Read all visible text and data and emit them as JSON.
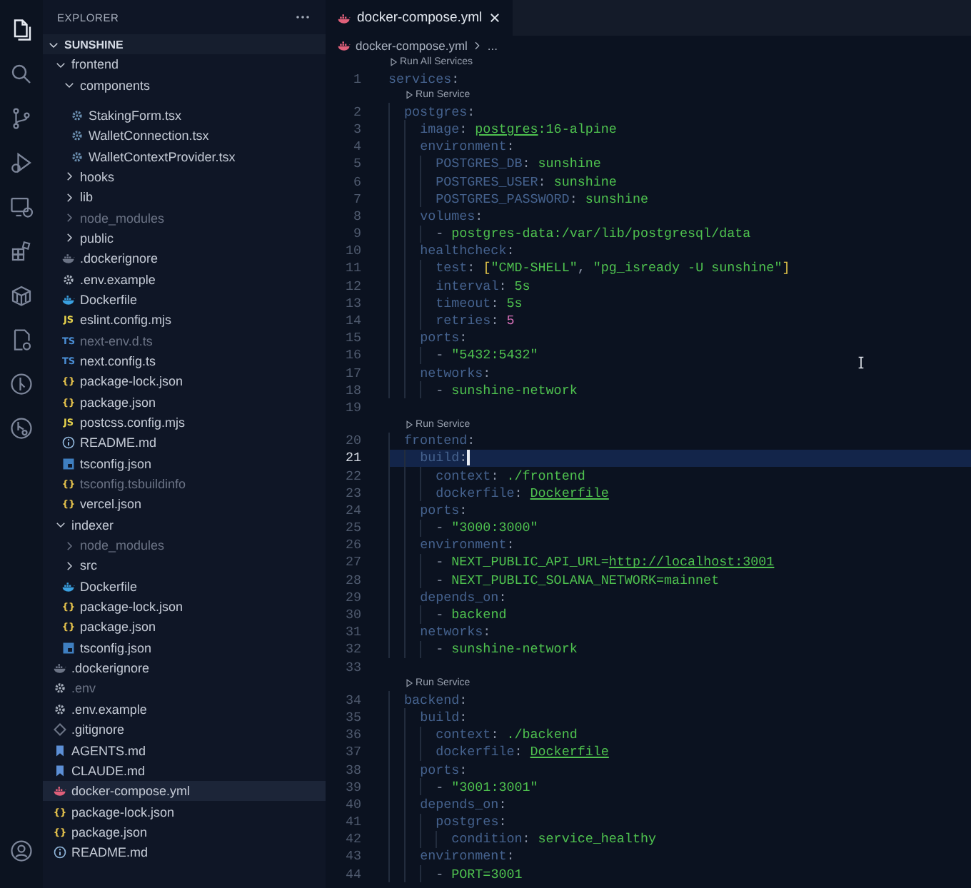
{
  "activity_bar": {
    "items": [
      {
        "kind": "files",
        "selected": true
      },
      {
        "kind": "search",
        "selected": false
      },
      {
        "kind": "scm",
        "selected": false
      },
      {
        "kind": "run",
        "selected": false
      },
      {
        "kind": "remote",
        "selected": false
      },
      {
        "kind": "extensions",
        "selected": false
      },
      {
        "kind": "containers",
        "selected": false
      },
      {
        "kind": "docs",
        "selected": false
      },
      {
        "kind": "graph",
        "selected": false
      },
      {
        "kind": "graph2",
        "selected": false
      }
    ],
    "account": {
      "kind": "account"
    }
  },
  "explorer": {
    "title": "EXPLORER",
    "root": {
      "label": "SUNSHINE",
      "expanded": true
    },
    "tree": [
      {
        "label": "frontend",
        "kind": "folder",
        "expanded": true,
        "selected": false,
        "dimmed": false,
        "children": [
          {
            "label": "components",
            "kind": "folder",
            "expanded": true,
            "selected": false,
            "dimmed": false,
            "children": [
              {
                "label": "StakingForm.tsx",
                "kind": "tsx",
                "selected": false,
                "dimmed": false
              },
              {
                "label": "WalletConnection.tsx",
                "kind": "tsx",
                "selected": false,
                "dimmed": false
              },
              {
                "label": "WalletContextProvider.tsx",
                "kind": "tsx",
                "selected": false,
                "dimmed": false
              }
            ]
          },
          {
            "label": "hooks",
            "kind": "folder",
            "expanded": false,
            "selected": false,
            "dimmed": false
          },
          {
            "label": "lib",
            "kind": "folder",
            "expanded": false,
            "selected": false,
            "dimmed": false
          },
          {
            "label": "node_modules",
            "kind": "folder",
            "expanded": false,
            "selected": false,
            "dimmed": true
          },
          {
            "label": "public",
            "kind": "folder",
            "expanded": false,
            "selected": false,
            "dimmed": false
          },
          {
            "label": ".dockerignore",
            "kind": "dockerignore",
            "selected": false,
            "dimmed": false
          },
          {
            "label": ".env.example",
            "kind": "env",
            "selected": false,
            "dimmed": false
          },
          {
            "label": "Dockerfile",
            "kind": "docker",
            "selected": false,
            "dimmed": false
          },
          {
            "label": "eslint.config.mjs",
            "kind": "js",
            "badge": "JS",
            "selected": false,
            "dimmed": false
          },
          {
            "label": "next-env.d.ts",
            "kind": "ts",
            "badge": "TS",
            "selected": false,
            "dimmed": true
          },
          {
            "label": "next.config.ts",
            "kind": "ts",
            "badge": "TS",
            "selected": false,
            "dimmed": false
          },
          {
            "label": "package-lock.json",
            "kind": "json",
            "badge": "{}",
            "selected": false,
            "dimmed": false
          },
          {
            "label": "package.json",
            "kind": "json",
            "badge": "{}",
            "selected": false,
            "dimmed": false
          },
          {
            "label": "postcss.config.mjs",
            "kind": "js",
            "badge": "JS",
            "selected": false,
            "dimmed": false
          },
          {
            "label": "README.md",
            "kind": "info",
            "selected": false,
            "dimmed": false
          },
          {
            "label": "tsconfig.json",
            "kind": "tsconfig",
            "selected": false,
            "dimmed": false
          },
          {
            "label": "tsconfig.tsbuildinfo",
            "kind": "json",
            "badge": "{}",
            "selected": false,
            "dimmed": true
          },
          {
            "label": "vercel.json",
            "kind": "json",
            "badge": "{}",
            "selected": false,
            "dimmed": false
          }
        ]
      },
      {
        "label": "indexer",
        "kind": "folder",
        "expanded": true,
        "selected": false,
        "dimmed": false,
        "children": [
          {
            "label": "node_modules",
            "kind": "folder",
            "expanded": false,
            "selected": false,
            "dimmed": true
          },
          {
            "label": "src",
            "kind": "folder",
            "expanded": false,
            "selected": false,
            "dimmed": false
          },
          {
            "label": "Dockerfile",
            "kind": "docker",
            "selected": false,
            "dimmed": false
          },
          {
            "label": "package-lock.json",
            "kind": "json",
            "badge": "{}",
            "selected": false,
            "dimmed": false
          },
          {
            "label": "package.json",
            "kind": "json",
            "badge": "{}",
            "selected": false,
            "dimmed": false
          },
          {
            "label": "tsconfig.json",
            "kind": "tsconfig",
            "selected": false,
            "dimmed": false
          }
        ]
      },
      {
        "label": ".dockerignore",
        "kind": "dockerignore",
        "selected": false,
        "dimmed": false
      },
      {
        "label": ".env",
        "kind": "env",
        "selected": false,
        "dimmed": true
      },
      {
        "label": ".env.example",
        "kind": "env",
        "selected": false,
        "dimmed": false
      },
      {
        "label": ".gitignore",
        "kind": "git",
        "selected": false,
        "dimmed": false
      },
      {
        "label": "AGENTS.md",
        "kind": "md",
        "selected": false,
        "dimmed": false
      },
      {
        "label": "CLAUDE.md",
        "kind": "md",
        "selected": false,
        "dimmed": false
      },
      {
        "label": "docker-compose.yml",
        "kind": "yml",
        "selected": true,
        "dimmed": false
      },
      {
        "label": "package-lock.json",
        "kind": "json",
        "badge": "{}",
        "selected": false,
        "dimmed": false
      },
      {
        "label": "package.json",
        "kind": "json",
        "badge": "{}",
        "selected": false,
        "dimmed": false
      },
      {
        "label": "README.md",
        "kind": "info",
        "selected": false,
        "dimmed": false
      }
    ]
  },
  "editor": {
    "tabs": [
      {
        "label": "docker-compose.yml",
        "selected": true
      }
    ],
    "breadcrumb": [
      "docker-compose.yml",
      "..."
    ],
    "lines": [
      {
        "kind": "lens",
        "text": "Run All Services"
      },
      {
        "kind": "code",
        "n": "1",
        "current": false,
        "tokens": [
          {
            "text": "services",
            "kind": "key"
          },
          {
            "text": ":",
            "kind": "punct"
          }
        ]
      },
      {
        "kind": "lens",
        "text": "Run Service"
      },
      {
        "kind": "code",
        "n": "2",
        "current": false,
        "tokens": [
          {
            "text": "  postgres",
            "kind": "key"
          },
          {
            "text": ":",
            "kind": "punct"
          }
        ]
      },
      {
        "kind": "code",
        "n": "3",
        "current": false,
        "tokens": [
          {
            "text": "    image",
            "kind": "key"
          },
          {
            "text": ": ",
            "kind": "punct"
          },
          {
            "text": "postgres",
            "kind": "link"
          },
          {
            "text": ":16-alpine",
            "kind": "string"
          }
        ]
      },
      {
        "kind": "code",
        "n": "4",
        "current": false,
        "tokens": [
          {
            "text": "    environment",
            "kind": "key"
          },
          {
            "text": ":",
            "kind": "punct"
          }
        ]
      },
      {
        "kind": "code",
        "n": "5",
        "current": false,
        "tokens": [
          {
            "text": "      POSTGRES_DB",
            "kind": "key"
          },
          {
            "text": ": ",
            "kind": "punct"
          },
          {
            "text": "sunshine",
            "kind": "string"
          }
        ]
      },
      {
        "kind": "code",
        "n": "6",
        "current": false,
        "tokens": [
          {
            "text": "      POSTGRES_USER",
            "kind": "key"
          },
          {
            "text": ": ",
            "kind": "punct"
          },
          {
            "text": "sunshine",
            "kind": "string"
          }
        ]
      },
      {
        "kind": "code",
        "n": "7",
        "current": false,
        "tokens": [
          {
            "text": "      POSTGRES_PASSWORD",
            "kind": "key"
          },
          {
            "text": ": ",
            "kind": "punct"
          },
          {
            "text": "sunshine",
            "kind": "string"
          }
        ]
      },
      {
        "kind": "code",
        "n": "8",
        "current": false,
        "tokens": [
          {
            "text": "    volumes",
            "kind": "key"
          },
          {
            "text": ":",
            "kind": "punct"
          }
        ]
      },
      {
        "kind": "code",
        "n": "9",
        "current": false,
        "tokens": [
          {
            "text": "      - ",
            "kind": "punct"
          },
          {
            "text": "postgres-data:/var/lib/postgresql/data",
            "kind": "string"
          }
        ]
      },
      {
        "kind": "code",
        "n": "10",
        "current": false,
        "tokens": [
          {
            "text": "    healthcheck",
            "kind": "key"
          },
          {
            "text": ":",
            "kind": "punct"
          }
        ]
      },
      {
        "kind": "code",
        "n": "11",
        "current": false,
        "tokens": [
          {
            "text": "      test",
            "kind": "key"
          },
          {
            "text": ": ",
            "kind": "punct"
          },
          {
            "text": "[",
            "kind": "bracket"
          },
          {
            "text": "\"CMD-SHELL\"",
            "kind": "string"
          },
          {
            "text": ", ",
            "kind": "punct"
          },
          {
            "text": "\"pg_isready -U sunshine\"",
            "kind": "string"
          },
          {
            "text": "]",
            "kind": "bracket"
          }
        ]
      },
      {
        "kind": "code",
        "n": "12",
        "current": false,
        "tokens": [
          {
            "text": "      interval",
            "kind": "key"
          },
          {
            "text": ": ",
            "kind": "punct"
          },
          {
            "text": "5s",
            "kind": "string"
          }
        ]
      },
      {
        "kind": "code",
        "n": "13",
        "current": false,
        "tokens": [
          {
            "text": "      timeout",
            "kind": "key"
          },
          {
            "text": ": ",
            "kind": "punct"
          },
          {
            "text": "5s",
            "kind": "string"
          }
        ]
      },
      {
        "kind": "code",
        "n": "14",
        "current": false,
        "tokens": [
          {
            "text": "      retries",
            "kind": "key"
          },
          {
            "text": ": ",
            "kind": "punct"
          },
          {
            "text": "5",
            "kind": "number"
          }
        ]
      },
      {
        "kind": "code",
        "n": "15",
        "current": false,
        "tokens": [
          {
            "text": "    ports",
            "kind": "key"
          },
          {
            "text": ":",
            "kind": "punct"
          }
        ]
      },
      {
        "kind": "code",
        "n": "16",
        "current": false,
        "tokens": [
          {
            "text": "      - ",
            "kind": "punct"
          },
          {
            "text": "\"5432:5432\"",
            "kind": "string"
          }
        ]
      },
      {
        "kind": "code",
        "n": "17",
        "current": false,
        "tokens": [
          {
            "text": "    networks",
            "kind": "key"
          },
          {
            "text": ":",
            "kind": "punct"
          }
        ]
      },
      {
        "kind": "code",
        "n": "18",
        "current": false,
        "tokens": [
          {
            "text": "      - ",
            "kind": "punct"
          },
          {
            "text": "sunshine-network",
            "kind": "string"
          }
        ]
      },
      {
        "kind": "code",
        "n": "19",
        "current": false
      },
      {
        "kind": "lens",
        "text": "Run Service"
      },
      {
        "kind": "code",
        "n": "20",
        "current": false,
        "tokens": [
          {
            "text": "  frontend",
            "kind": "key"
          },
          {
            "text": ":",
            "kind": "punct"
          }
        ]
      },
      {
        "kind": "code",
        "n": "21",
        "current": true,
        "tokens": [
          {
            "text": "    build",
            "kind": "key"
          },
          {
            "text": ":",
            "kind": "punct"
          }
        ]
      },
      {
        "kind": "code",
        "n": "22",
        "current": false,
        "tokens": [
          {
            "text": "      context",
            "kind": "key"
          },
          {
            "text": ": ",
            "kind": "punct"
          },
          {
            "text": "./frontend",
            "kind": "string"
          }
        ]
      },
      {
        "kind": "code",
        "n": "23",
        "current": false,
        "tokens": [
          {
            "text": "      dockerfile",
            "kind": "key"
          },
          {
            "text": ": ",
            "kind": "punct"
          },
          {
            "text": "Dockerfile",
            "kind": "link"
          }
        ]
      },
      {
        "kind": "code",
        "n": "24",
        "current": false,
        "tokens": [
          {
            "text": "    ports",
            "kind": "key"
          },
          {
            "text": ":",
            "kind": "punct"
          }
        ]
      },
      {
        "kind": "code",
        "n": "25",
        "current": false,
        "tokens": [
          {
            "text": "      - ",
            "kind": "punct"
          },
          {
            "text": "\"3000:3000\"",
            "kind": "string"
          }
        ]
      },
      {
        "kind": "code",
        "n": "26",
        "current": false,
        "tokens": [
          {
            "text": "    environment",
            "kind": "key"
          },
          {
            "text": ":",
            "kind": "punct"
          }
        ]
      },
      {
        "kind": "code",
        "n": "27",
        "current": false,
        "tokens": [
          {
            "text": "      - ",
            "kind": "punct"
          },
          {
            "text": "NEXT_PUBLIC_API_URL=",
            "kind": "string"
          },
          {
            "text": "http://localhost:3001",
            "kind": "link"
          }
        ]
      },
      {
        "kind": "code",
        "n": "28",
        "current": false,
        "tokens": [
          {
            "text": "      - ",
            "kind": "punct"
          },
          {
            "text": "NEXT_PUBLIC_SOLANA_NETWORK=mainnet",
            "kind": "string"
          }
        ]
      },
      {
        "kind": "code",
        "n": "29",
        "current": false,
        "tokens": [
          {
            "text": "    depends_on",
            "kind": "key"
          },
          {
            "text": ":",
            "kind": "punct"
          }
        ]
      },
      {
        "kind": "code",
        "n": "30",
        "current": false,
        "tokens": [
          {
            "text": "      - ",
            "kind": "punct"
          },
          {
            "text": "backend",
            "kind": "string"
          }
        ]
      },
      {
        "kind": "code",
        "n": "31",
        "current": false,
        "tokens": [
          {
            "text": "    networks",
            "kind": "key"
          },
          {
            "text": ":",
            "kind": "punct"
          }
        ]
      },
      {
        "kind": "code",
        "n": "32",
        "current": false,
        "tokens": [
          {
            "text": "      - ",
            "kind": "punct"
          },
          {
            "text": "sunshine-network",
            "kind": "string"
          }
        ]
      },
      {
        "kind": "code",
        "n": "33",
        "current": false
      },
      {
        "kind": "lens",
        "text": "Run Service"
      },
      {
        "kind": "code",
        "n": "34",
        "current": false,
        "tokens": [
          {
            "text": "  backend",
            "kind": "key"
          },
          {
            "text": ":",
            "kind": "punct"
          }
        ]
      },
      {
        "kind": "code",
        "n": "35",
        "current": false,
        "tokens": [
          {
            "text": "    build",
            "kind": "key"
          },
          {
            "text": ":",
            "kind": "punct"
          }
        ]
      },
      {
        "kind": "code",
        "n": "36",
        "current": false,
        "tokens": [
          {
            "text": "      context",
            "kind": "key"
          },
          {
            "text": ": ",
            "kind": "punct"
          },
          {
            "text": "./backend",
            "kind": "string"
          }
        ]
      },
      {
        "kind": "code",
        "n": "37",
        "current": false,
        "tokens": [
          {
            "text": "      dockerfile",
            "kind": "key"
          },
          {
            "text": ": ",
            "kind": "punct"
          },
          {
            "text": "Dockerfile",
            "kind": "link"
          }
        ]
      },
      {
        "kind": "code",
        "n": "38",
        "current": false,
        "tokens": [
          {
            "text": "    ports",
            "kind": "key"
          },
          {
            "text": ":",
            "kind": "punct"
          }
        ]
      },
      {
        "kind": "code",
        "n": "39",
        "current": false,
        "tokens": [
          {
            "text": "      - ",
            "kind": "punct"
          },
          {
            "text": "\"3001:3001\"",
            "kind": "string"
          }
        ]
      },
      {
        "kind": "code",
        "n": "40",
        "current": false,
        "tokens": [
          {
            "text": "    depends_on",
            "kind": "key"
          },
          {
            "text": ":",
            "kind": "punct"
          }
        ]
      },
      {
        "kind": "code",
        "n": "41",
        "current": false,
        "tokens": [
          {
            "text": "      postgres",
            "kind": "key"
          },
          {
            "text": ":",
            "kind": "punct"
          }
        ]
      },
      {
        "kind": "code",
        "n": "42",
        "current": false,
        "tokens": [
          {
            "text": "        condition",
            "kind": "key"
          },
          {
            "text": ": ",
            "kind": "punct"
          },
          {
            "text": "service_healthy",
            "kind": "string"
          }
        ]
      },
      {
        "kind": "code",
        "n": "43",
        "current": false,
        "tokens": [
          {
            "text": "    environment",
            "kind": "key"
          },
          {
            "text": ":",
            "kind": "punct"
          }
        ]
      },
      {
        "kind": "code",
        "n": "44",
        "current": false,
        "tokens": [
          {
            "text": "      - ",
            "kind": "punct"
          },
          {
            "text": "PORT=3001",
            "kind": "string"
          }
        ]
      }
    ]
  }
}
